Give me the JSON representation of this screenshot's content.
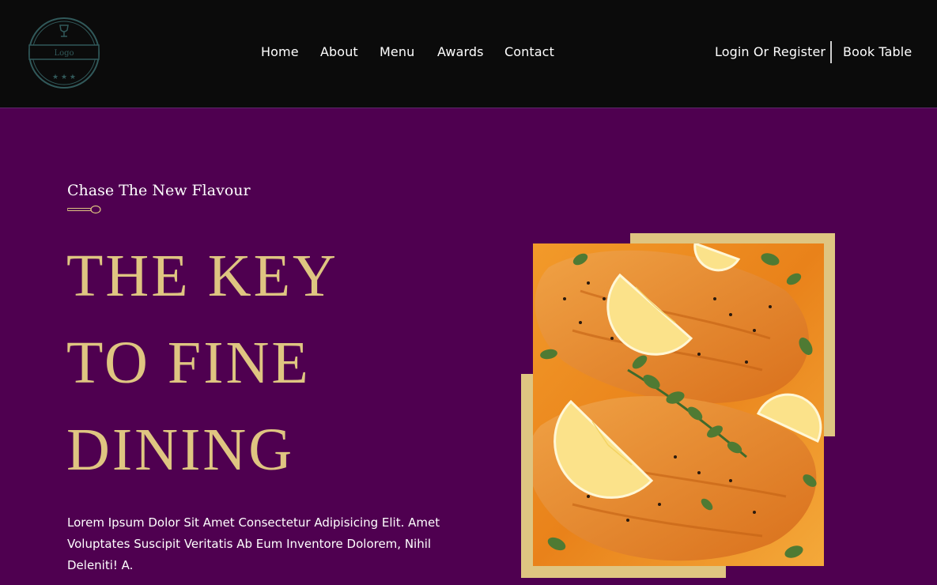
{
  "header": {
    "logo_text": "Logo",
    "nav": [
      "Home",
      "About",
      "Menu",
      "Awards",
      "Contact"
    ],
    "login_label": "Login Or Register",
    "book_label": "Book Table"
  },
  "hero": {
    "subtitle": "Chase The New Flavour",
    "headline": [
      "THE KEY",
      "TO FINE",
      "DINING"
    ],
    "paragraph": "Lorem Ipsum Dolor Sit Amet Consectetur Adipisicing Elit. Amet Voluptates Suscipit Veritatis Ab Eum Inventore Dolorem, Nihil Deleniti! A."
  },
  "colors": {
    "background": "#4f0050",
    "header_bg": "#0b0b0b",
    "accent_gold": "#dfc581",
    "text": "#ffffff"
  },
  "icons": {
    "logo": "wine-glass-badge",
    "divider": "spoon-icon"
  }
}
